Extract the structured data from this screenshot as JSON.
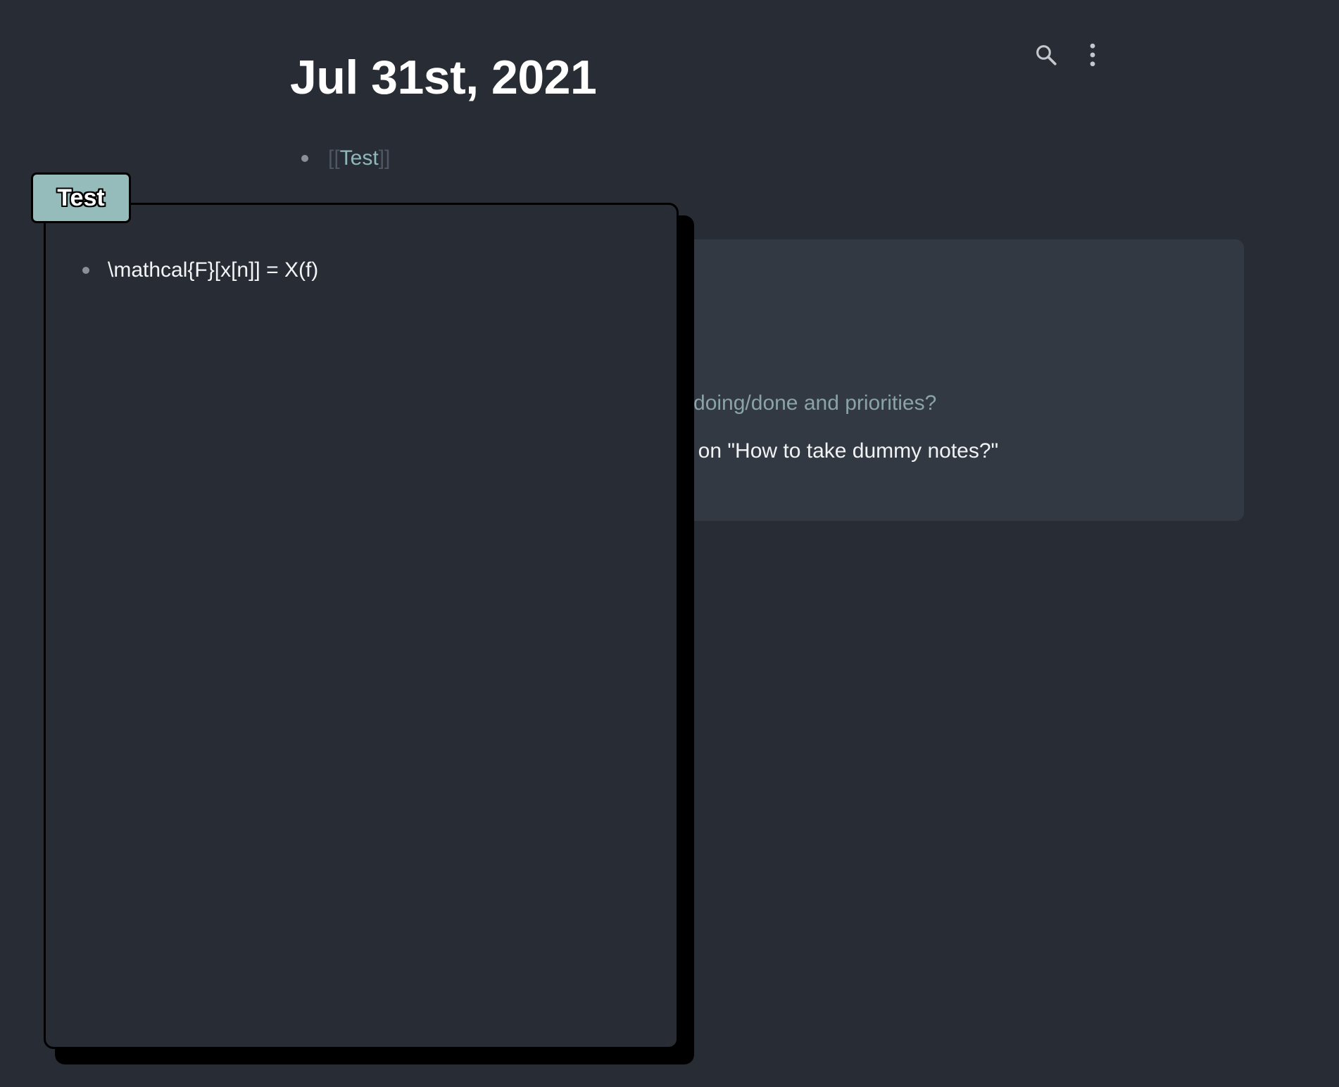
{
  "page": {
    "title": "Jul 31st, 2021"
  },
  "toolbar": {
    "search_icon": "search-icon",
    "more_icon": "more-vertical-icon"
  },
  "journal": {
    "block": {
      "open_brackets": "[[",
      "ref_label": "Test",
      "close_brackets": "]]"
    }
  },
  "references": {
    "line1": "o/doing/done and priorities?",
    "line2": "al on \"How to take dummy notes?\""
  },
  "popup": {
    "tab_label": "Test",
    "block_text": "\\mathcal{F}[x[n]] = X(f)"
  },
  "colors": {
    "background": "#272c35",
    "card": "#333942",
    "link": "#8fb8bb",
    "tab": "#95bbbb"
  }
}
